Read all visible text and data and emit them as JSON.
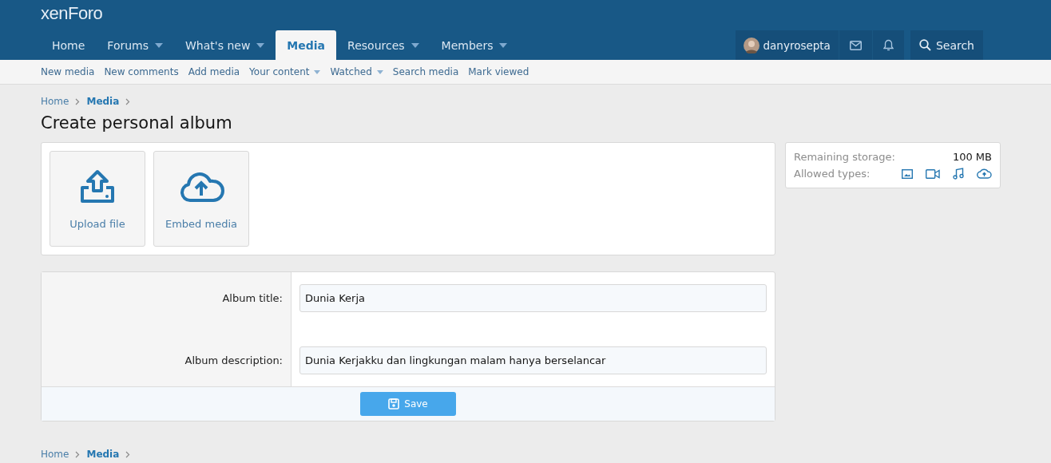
{
  "logo": "xenForo",
  "nav_tabs": [
    {
      "label": "Home",
      "selected": false,
      "has_menu": false
    },
    {
      "label": "Forums",
      "selected": false,
      "has_menu": true
    },
    {
      "label": "What's new",
      "selected": false,
      "has_menu": true
    },
    {
      "label": "Media",
      "selected": true,
      "has_menu": false
    },
    {
      "label": "Resources",
      "selected": false,
      "has_menu": true
    },
    {
      "label": "Members",
      "selected": false,
      "has_menu": true
    }
  ],
  "user": {
    "name": "danyrosepta"
  },
  "search": {
    "label": "Search"
  },
  "sub_nav": [
    {
      "label": "New media",
      "has_menu": false
    },
    {
      "label": "New comments",
      "has_menu": false
    },
    {
      "label": "Add media",
      "has_menu": false
    },
    {
      "label": "Your content",
      "has_menu": true
    },
    {
      "label": "Watched",
      "has_menu": true
    },
    {
      "label": "Search media",
      "has_menu": false
    },
    {
      "label": "Mark viewed",
      "has_menu": false
    }
  ],
  "breadcrumb": [
    {
      "label": "Home",
      "current": false
    },
    {
      "label": "Media",
      "current": true
    }
  ],
  "title": "Create personal album",
  "add_actions": [
    {
      "kind": "upload",
      "label": "Upload file"
    },
    {
      "kind": "embed",
      "label": "Embed media"
    }
  ],
  "storage": {
    "remaining_label": "Remaining storage:",
    "remaining_value": "100 MB",
    "types_label": "Allowed types:",
    "types": [
      {
        "kind": "image"
      },
      {
        "kind": "video"
      },
      {
        "kind": "audio"
      },
      {
        "kind": "embed"
      }
    ]
  },
  "form": {
    "fields": [
      {
        "label": "Album title:",
        "value": "Dunia Kerja"
      },
      {
        "label": "Album description:",
        "value": "Dunia Kerjakku dan lingkungan malam hanya berselancar"
      }
    ],
    "submit": "Save"
  },
  "footer_breadcrumb": [
    {
      "label": "Home",
      "current": false
    },
    {
      "label": "Media",
      "current": true
    }
  ]
}
